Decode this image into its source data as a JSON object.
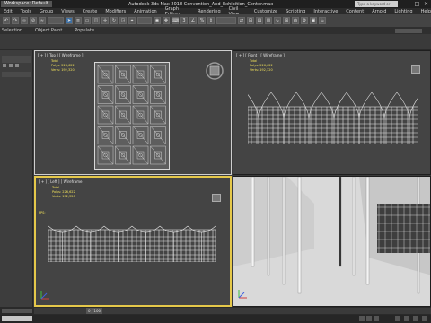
{
  "title_bar": {
    "workspace": "Workspace: Default",
    "app_title": "Autodesk 3ds Max 2018    Convention_And_Exhibition_Center.max",
    "search_placeholder": "Type a keyword or phrase"
  },
  "menu": [
    "Edit",
    "Tools",
    "Group",
    "Views",
    "Create",
    "Modifiers",
    "Animation",
    "Graph Editors",
    "Rendering",
    "Civil View",
    "Customize",
    "Scripting",
    "Interactive",
    "Content",
    "Arnold",
    "Lighting",
    "Help"
  ],
  "ribbon": {
    "tabs": [
      "Selection",
      "Object Paint",
      "Populate"
    ]
  },
  "viewports": {
    "top": {
      "label": "[ + ] [ Top ] [ Wireframe ]",
      "stats_header": "Total",
      "polys": "Polys:   226,622",
      "verts": "Verts:   192,320"
    },
    "front": {
      "label": "[ + ] [ Front ] [ Wireframe ]",
      "stats_header": "Total",
      "polys": "Polys:   226,622",
      "verts": "Verts:   192,320"
    },
    "left": {
      "label": "[ + ] [ Left ] [ Wireframe ]",
      "stats_header": "Total",
      "polys": "Polys:   226,622",
      "verts": "Verts:   192,320",
      "fps": "FPS:"
    },
    "perspective": {}
  },
  "status_bar": {
    "frame_counter": "0 / 100"
  },
  "colors": {
    "viewport_bg": "#444444",
    "active_viewport_border": "#e5c84a",
    "stats_text": "#f2e25a",
    "render_bg": "#d8d8d8"
  }
}
